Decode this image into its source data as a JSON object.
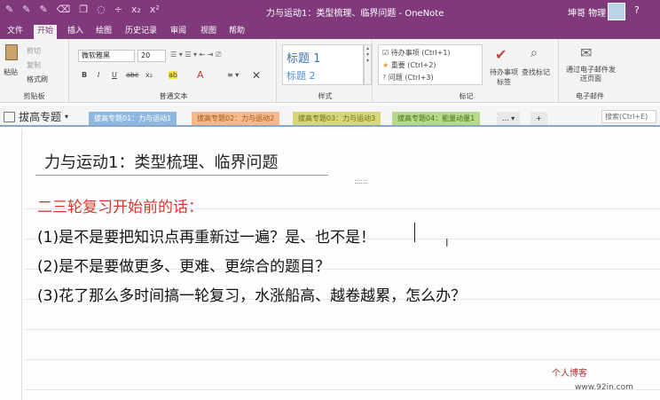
{
  "window": {
    "title": "力与运动1：类型梳理、临界问题 - OneNote",
    "user": "坤哥 物理",
    "help": "?"
  },
  "qat": {
    "icons": [
      "pen-icon",
      "pen-icon",
      "pen-icon",
      "eraser-icon",
      "copy-icon",
      "lasso-icon",
      "divide-icon",
      "subscript-icon",
      "superscript-icon"
    ]
  },
  "tabs": [
    "文件",
    "开始",
    "插入",
    "绘图",
    "历史记录",
    "审阅",
    "视图",
    "帮助"
  ],
  "ribbon": {
    "clipboard": {
      "paste": "粘贴",
      "cut": "剪切",
      "copy": "复制",
      "format_painter": "格式刷",
      "label": "剪贴板"
    },
    "basic_text": {
      "font": "微软雅黑",
      "size": "20",
      "label": "普通文本",
      "bold": "B",
      "italic": "I",
      "underline": "U",
      "strike": "abc",
      "subscript": "x₂",
      "highlight": "ab",
      "font_color": "A"
    },
    "styles": {
      "style1": "标题 1",
      "style2": "标题 2",
      "label": "样式"
    },
    "tags": {
      "items": [
        "待办事项 (Ctrl+1)",
        "重要 (Ctrl+2)",
        "问题 (Ctrl+3)"
      ],
      "label": "标记",
      "todo_tag": "待办事项\n标签",
      "find_tags": "查找标记"
    },
    "email": {
      "label_btn": "通过电子邮件发送页面",
      "label": "电子邮件"
    }
  },
  "navbar": {
    "notebook": "拔高专题",
    "sections": [
      "拔高专题01：力与运动1",
      "拔高专题02：力与运动2",
      "拔高专题03：力与运动3",
      "拔高专题04：能量动量1"
    ],
    "more": "...",
    "add": "+",
    "search_placeholder": "搜索(Ctrl+E)",
    "colors": {
      "s1": "#8fb8e0",
      "s2": "#f5b98c",
      "s3": "#d7d77a",
      "s4": "#b6d98c"
    }
  },
  "page": {
    "title": "力与运动1：类型梳理、临界问题",
    "heading": "二三轮复习开始前的话：",
    "questions": [
      "(1)是不是要把知识点再重新过一遍？是、也不是！",
      "(2)是不是要做更多、更难、更综合的题目？",
      "(3)花了那么多时间搞一轮复习，水涨船高、越卷越累，怎么办？"
    ]
  },
  "watermark": {
    "line1": "个人博客",
    "line2": "www.92in.com"
  }
}
